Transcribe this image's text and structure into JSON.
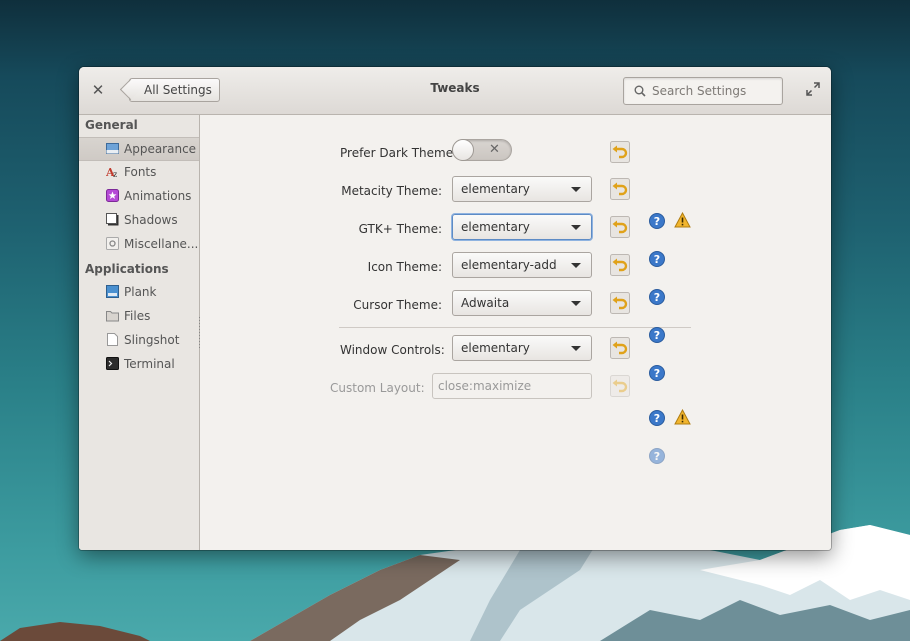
{
  "window": {
    "title": "Tweaks",
    "back_label": "All Settings",
    "search_placeholder": "Search Settings"
  },
  "sidebar": {
    "sections": [
      {
        "heading": "General",
        "items": [
          {
            "label": "Appearance",
            "icon": "appearance-icon",
            "selected": true
          },
          {
            "label": "Fonts",
            "icon": "fonts-icon"
          },
          {
            "label": "Animations",
            "icon": "animations-icon"
          },
          {
            "label": "Shadows",
            "icon": "shadows-icon"
          },
          {
            "label": "Miscellane...",
            "icon": "miscellaneous-icon"
          }
        ]
      },
      {
        "heading": "Applications",
        "items": [
          {
            "label": "Plank",
            "icon": "plank-icon"
          },
          {
            "label": "Files",
            "icon": "files-icon"
          },
          {
            "label": "Slingshot",
            "icon": "slingshot-icon"
          },
          {
            "label": "Terminal",
            "icon": "terminal-icon"
          }
        ]
      }
    ]
  },
  "settings": {
    "prefer_dark": {
      "label": "Prefer Dark Theme:",
      "state": "off"
    },
    "metacity": {
      "label": "Metacity Theme:",
      "value": "elementary"
    },
    "gtk": {
      "label": "GTK+ Theme:",
      "value": "elementary"
    },
    "icon": {
      "label": "Icon Theme:",
      "value": "elementary-add"
    },
    "cursor": {
      "label": "Cursor Theme:",
      "value": "Adwaita"
    },
    "window_controls": {
      "label": "Window Controls:",
      "value": "elementary"
    },
    "custom_layout": {
      "label": "Custom Layout:",
      "value": "close:maximize"
    }
  },
  "colors": {
    "help_blue": "#3b78c9",
    "warning_yellow": "#f1b52e",
    "focus_blue": "#5d8bc5"
  }
}
